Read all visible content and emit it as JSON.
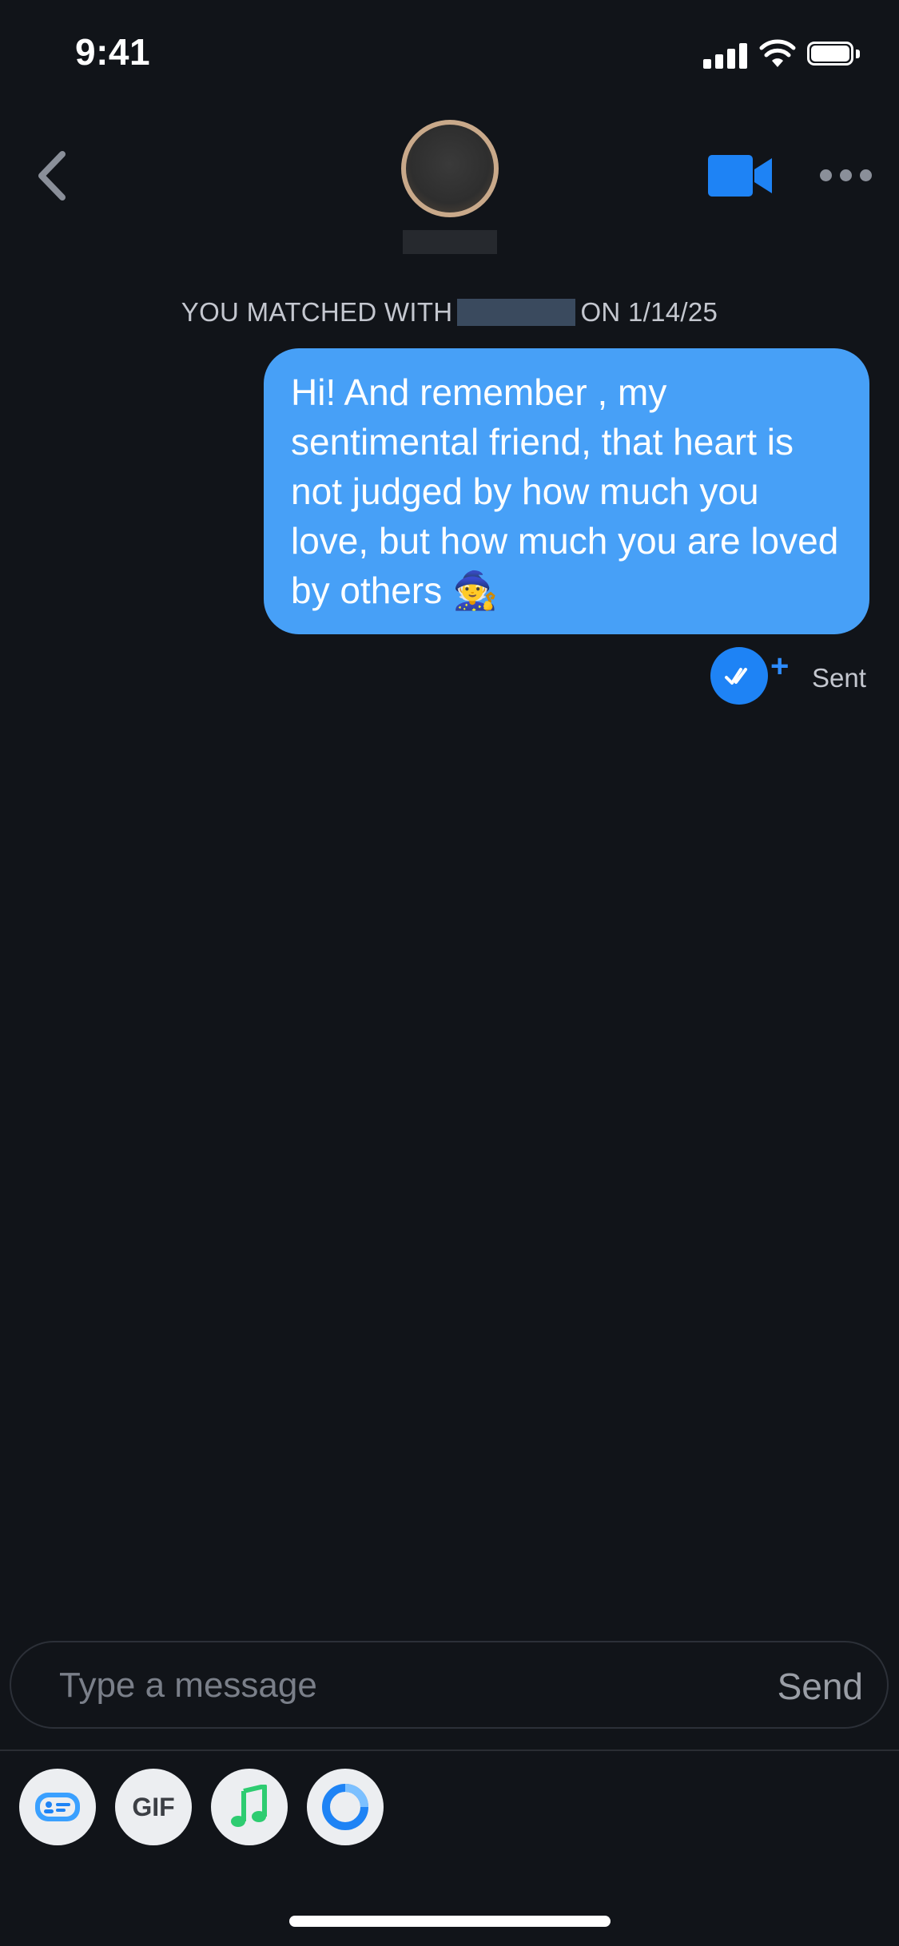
{
  "status_bar": {
    "time": "9:41"
  },
  "header": {
    "back_icon": "chevron-left-icon",
    "video_icon": "video-camera-icon",
    "more_icon": "ellipsis-icon",
    "accent_color": "#1e83f5"
  },
  "match_notice": {
    "prefix": "YOU MATCHED WITH",
    "date": "ON 1/14/25"
  },
  "messages": [
    {
      "text": "Hi! And remember , my sentimental friend, that heart is not judged by how much you love, but how much you are loved by others 🧙",
      "bubble_color": "#47a0f7",
      "status": "Sent",
      "plus": "+"
    }
  ],
  "composer": {
    "placeholder": "Type a message",
    "send_label": "Send"
  },
  "toolbar": {
    "items": [
      {
        "icon": "sticker-card-icon"
      },
      {
        "icon": "gif-icon",
        "label": "GIF"
      },
      {
        "icon": "music-note-icon",
        "color": "#2ecc71"
      },
      {
        "icon": "ring-icon",
        "color": "#1e83f5"
      }
    ]
  }
}
